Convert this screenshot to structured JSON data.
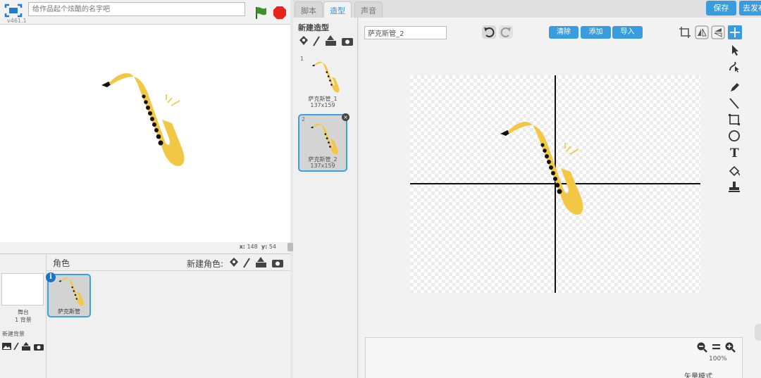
{
  "header": {
    "version": "v461.1",
    "title_placeholder": "给作品起个炫酷的名字吧"
  },
  "stage": {
    "x_label": "x:",
    "x_value": "148",
    "y_label": "y:",
    "y_value": "54"
  },
  "sprites_pane": {
    "title": "角色",
    "new_sprite_label": "新建角色:",
    "stage_label": "舞台",
    "stage_backdrops": "1 背景",
    "new_backdrop_label": "新建背景",
    "sprite_name": "萨克斯管",
    "info_badge": "i"
  },
  "tabs": [
    {
      "label": "脚本"
    },
    {
      "label": "造型"
    },
    {
      "label": "声音"
    }
  ],
  "top_buttons": {
    "save": "保存",
    "share": "去发布"
  },
  "costumes": {
    "new_costume_label": "新建造型",
    "items": [
      {
        "number": "1",
        "name": "萨克斯管_1",
        "size": "137x159"
      },
      {
        "number": "2",
        "name": "萨克斯管_2",
        "size": "137x159"
      }
    ]
  },
  "editor": {
    "costume_name_value": "萨克斯管_2",
    "clear_label": "清除",
    "add_label": "添加",
    "import_label": "导入",
    "zoom_percent": "100%",
    "mode_label": "矢量模式"
  },
  "colors": {
    "accent": "#3a9cdf",
    "saxophone": "#f2c744",
    "selected_border": "#3aa0e8"
  }
}
